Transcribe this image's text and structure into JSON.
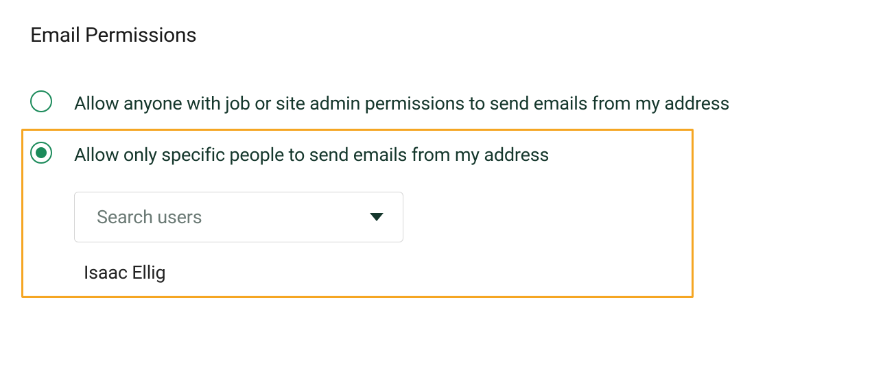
{
  "section": {
    "title": "Email Permissions"
  },
  "options": {
    "anyone": {
      "label": "Allow anyone with job or site admin permissions to send emails from my address",
      "selected": false
    },
    "specific": {
      "label": "Allow only specific people to send emails from my address",
      "selected": true
    }
  },
  "search": {
    "placeholder": "Search users"
  },
  "selected_users": [
    "Isaac Ellig"
  ]
}
